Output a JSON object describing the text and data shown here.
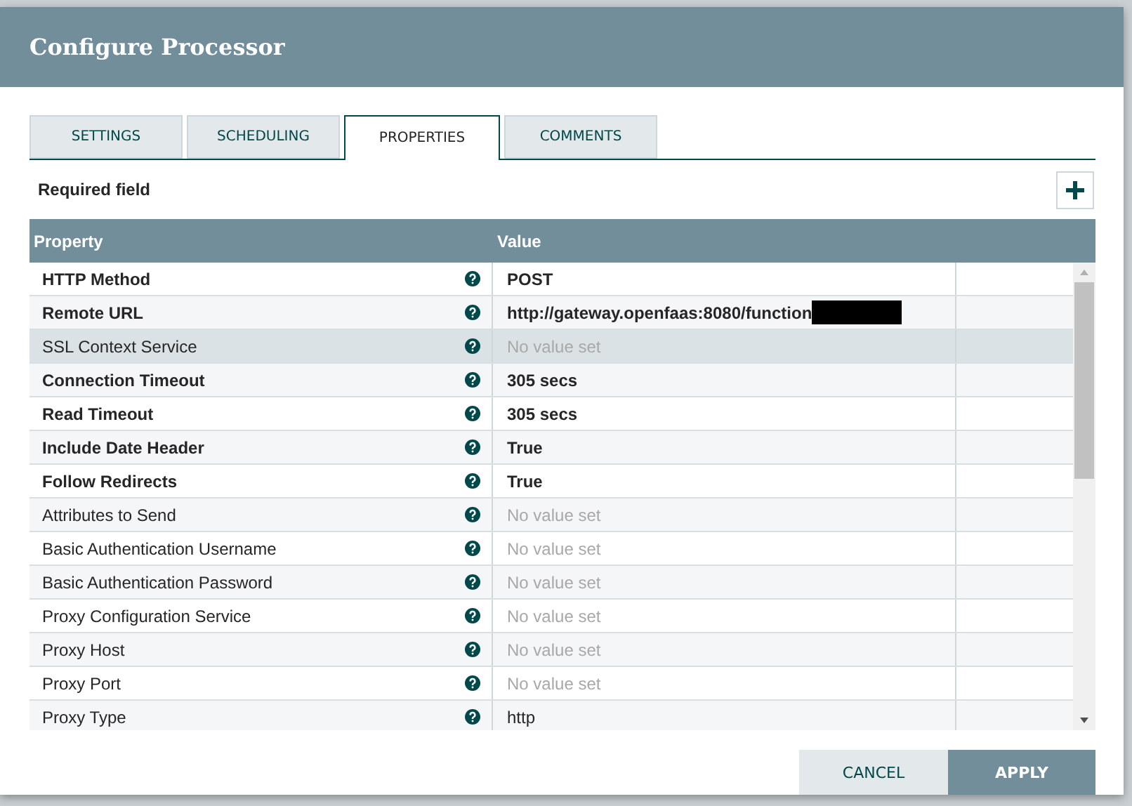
{
  "dialog": {
    "title": "Configure Processor"
  },
  "tabs": [
    {
      "label": "SETTINGS",
      "selected": false
    },
    {
      "label": "SCHEDULING",
      "selected": false
    },
    {
      "label": "PROPERTIES",
      "selected": true
    },
    {
      "label": "COMMENTS",
      "selected": false
    }
  ],
  "required_note": "Required field",
  "table": {
    "columns": [
      "Property",
      "Value"
    ],
    "rows": [
      {
        "property": "HTTP Method",
        "value": "POST",
        "required": true,
        "value_set": true,
        "selected": false,
        "redacted": false
      },
      {
        "property": "Remote URL",
        "value": "http://gateway.openfaas:8080/function",
        "required": true,
        "value_set": true,
        "selected": false,
        "redacted": true
      },
      {
        "property": "SSL Context Service",
        "value": "No value set",
        "required": false,
        "value_set": false,
        "selected": true,
        "redacted": false
      },
      {
        "property": "Connection Timeout",
        "value": "305 secs",
        "required": true,
        "value_set": true,
        "selected": false,
        "redacted": false
      },
      {
        "property": "Read Timeout",
        "value": "305 secs",
        "required": true,
        "value_set": true,
        "selected": false,
        "redacted": false
      },
      {
        "property": "Include Date Header",
        "value": "True",
        "required": true,
        "value_set": true,
        "selected": false,
        "redacted": false
      },
      {
        "property": "Follow Redirects",
        "value": "True",
        "required": true,
        "value_set": true,
        "selected": false,
        "redacted": false
      },
      {
        "property": "Attributes to Send",
        "value": "No value set",
        "required": false,
        "value_set": false,
        "selected": false,
        "redacted": false
      },
      {
        "property": "Basic Authentication Username",
        "value": "No value set",
        "required": false,
        "value_set": false,
        "selected": false,
        "redacted": false
      },
      {
        "property": "Basic Authentication Password",
        "value": "No value set",
        "required": false,
        "value_set": false,
        "selected": false,
        "redacted": false
      },
      {
        "property": "Proxy Configuration Service",
        "value": "No value set",
        "required": false,
        "value_set": false,
        "selected": false,
        "redacted": false
      },
      {
        "property": "Proxy Host",
        "value": "No value set",
        "required": false,
        "value_set": false,
        "selected": false,
        "redacted": false
      },
      {
        "property": "Proxy Port",
        "value": "No value set",
        "required": false,
        "value_set": false,
        "selected": false,
        "redacted": false
      },
      {
        "property": "Proxy Type",
        "value": "http",
        "required": false,
        "value_set": true,
        "selected": false,
        "redacted": false
      }
    ]
  },
  "buttons": [
    {
      "label": "CANCEL",
      "kind": "secondary"
    },
    {
      "label": "APPLY",
      "kind": "primary"
    }
  ]
}
